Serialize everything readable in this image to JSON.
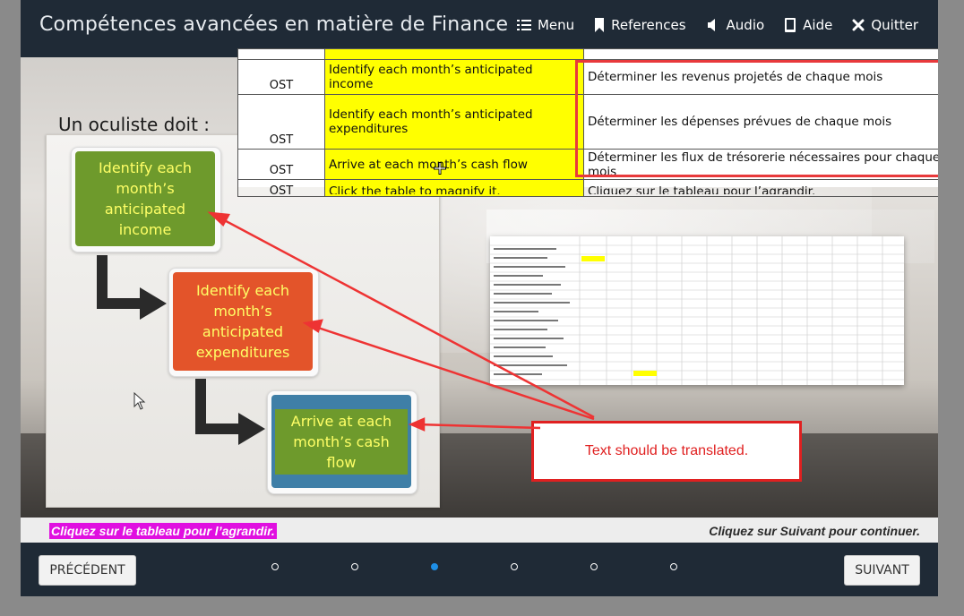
{
  "header": {
    "title": "Compétences avancées en matière de Finance",
    "nav": [
      {
        "label": "Menu",
        "icon": "list-icon"
      },
      {
        "label": "References",
        "icon": "bookmark-icon"
      },
      {
        "label": "Audio",
        "icon": "speaker-icon"
      },
      {
        "label": "Aide",
        "icon": "book-icon"
      },
      {
        "label": "Quitter",
        "icon": "close-icon"
      }
    ]
  },
  "slide": {
    "intro": "Un oculiste doit :",
    "steps": [
      "Identify each month’s anticipated income",
      "Identify each month’s anticipated expenditures",
      "Arrive at each month’s cash flow"
    ]
  },
  "annotation": {
    "table": {
      "rows": [
        {
          "ost": "OST",
          "source": "Identify each month’s anticipated income",
          "target": "Déterminer les revenus projetés de chaque mois"
        },
        {
          "ost": "OST",
          "source": "Identify each month’s anticipated expenditures",
          "target": "Déterminer les dépenses prévues de chaque mois"
        },
        {
          "ost": "OST",
          "source": "Arrive at each month’s cash flow",
          "target": "Déterminer les flux de trésorerie nécessaires pour chaque mois"
        },
        {
          "ost": "OST",
          "source": "Click the table to magnify it.",
          "target": "Cliquez sur le tableau pour l’agrandir."
        }
      ]
    },
    "note": "Text should be translated.",
    "colors": {
      "highlight": "#ffff00",
      "box": "#e02020"
    }
  },
  "instructions": {
    "left": "Cliquez sur le tableau pour l’agrandir.",
    "right": "Cliquez sur Suivant pour continuer."
  },
  "footer": {
    "prev_label": "PRÉCÉDENT",
    "next_label": "SUIVANT",
    "pages": 6,
    "current_page": 3
  },
  "colors": {
    "header_bg": "#1f2a36",
    "step1": "#6e9a2c",
    "step2": "#e3542a",
    "step3": "#3f7fa7",
    "active_dot": "#1e8fe6"
  }
}
